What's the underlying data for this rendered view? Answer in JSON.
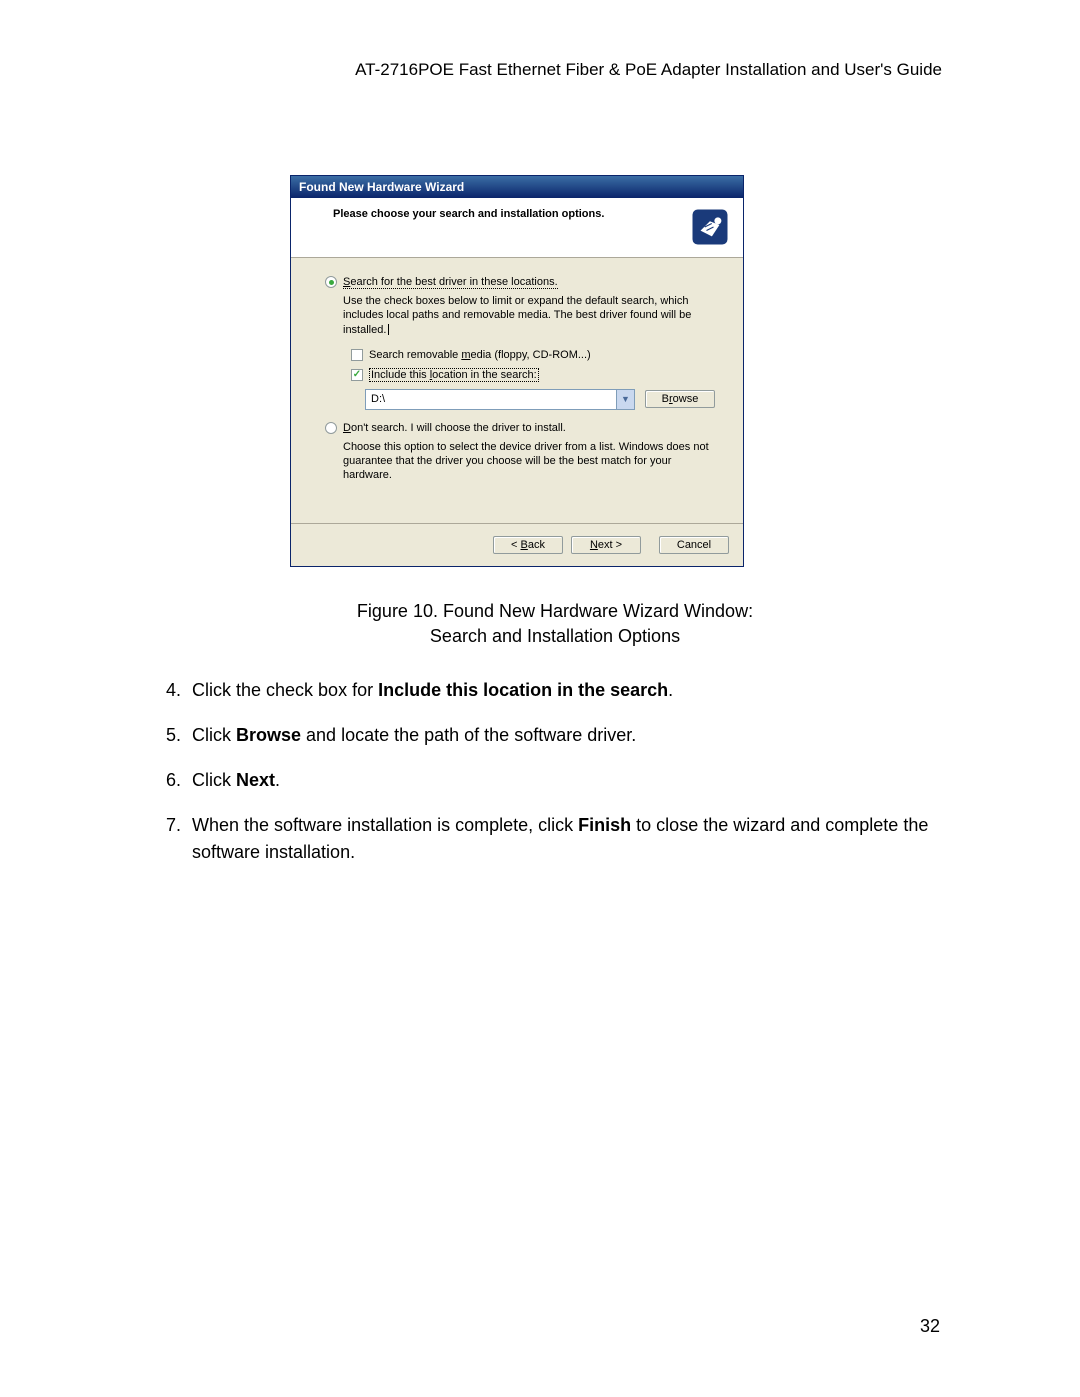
{
  "header": "AT-2716POE Fast Ethernet Fiber & PoE Adapter Installation and User's Guide",
  "dialog": {
    "title": "Found New Hardware Wizard",
    "header_title": "Please choose your search and installation options.",
    "icon_name": "hardware-icon",
    "opt1_pre": "S",
    "opt1_post": "earch for the best driver in these locations.",
    "opt1_desc": "Use the check boxes below to limit or expand the default search, which includes local paths and removable media. The best driver found will be installed.",
    "cb1_pre": "Search removable ",
    "cb1_u": "m",
    "cb1_post": "edia (floppy, CD-ROM...)",
    "cb2_pre": "Include this ",
    "cb2_u": "l",
    "cb2_post": "ocation in the search:",
    "path_value": "D:\\",
    "browse_pre": "B",
    "browse_u": "r",
    "browse_post": "owse",
    "opt2_pre": "D",
    "opt2_post": "on't search. I will choose the driver to install.",
    "opt2_desc": "Choose this option to select the device driver from a list. Windows does not guarantee that the driver you choose will be the best match for your hardware.",
    "back_pre": "< ",
    "back_u": "B",
    "back_post": "ack",
    "next_u": "N",
    "next_post": "ext >",
    "cancel": "Cancel"
  },
  "caption_line1": "Figure 10. Found New Hardware Wizard Window:",
  "caption_line2": "Search and Installation Options",
  "steps": {
    "s4_a": "Click the check box for ",
    "s4_b": "Include this location in the search",
    "s4_c": ".",
    "s5_a": "Click ",
    "s5_b": "Browse",
    "s5_c": " and locate the path of the software driver.",
    "s6_a": "Click ",
    "s6_b": "Next",
    "s6_c": ".",
    "s7_a": "When the software installation is complete, click ",
    "s7_b": "Finish",
    "s7_c": " to close the wizard and complete the software installation."
  },
  "page_number": "32"
}
